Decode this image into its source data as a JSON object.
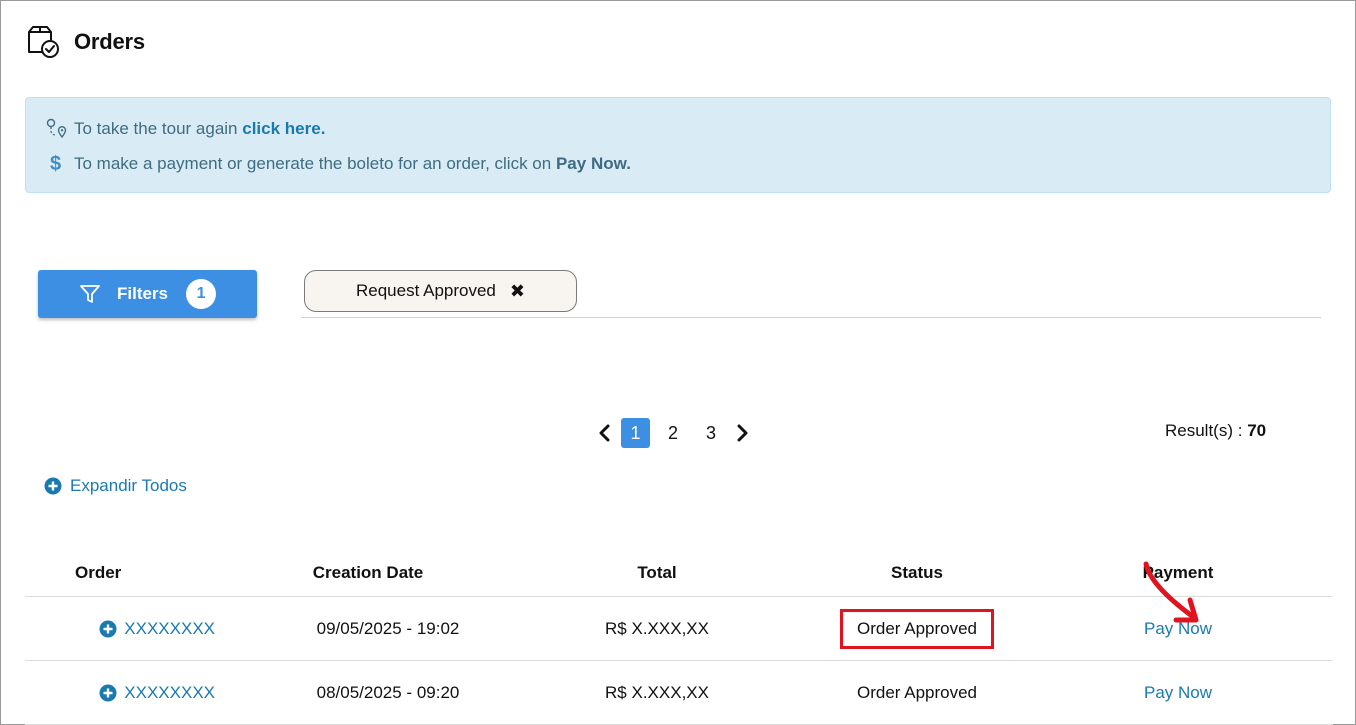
{
  "header": {
    "title": "Orders",
    "icon": "box-check-icon"
  },
  "info": {
    "tour_text": "To take the tour again ",
    "tour_link": "click here.",
    "payment_text": "To make a payment or generate the boleto for an order, click on ",
    "payment_bold": "Pay Now.",
    "dollar": "$"
  },
  "filters": {
    "label": "Filters",
    "count": "1",
    "chip_label": "Request Approved",
    "chip_close": "✖"
  },
  "pagination": {
    "pages": [
      "1",
      "2",
      "3"
    ],
    "active": "1"
  },
  "results": {
    "label": "Result(s) : ",
    "count": "70"
  },
  "expand_all": "Expandir Todos",
  "table": {
    "headers": {
      "order": "Order",
      "date": "Creation Date",
      "total": "Total",
      "status": "Status",
      "payment": "Payment"
    },
    "rows": [
      {
        "order": "XXXXXXXX",
        "date": "09/05/2025 - 19:02",
        "total": "R$ X.XXX,XX",
        "status": "Order Approved",
        "payment": "Pay Now"
      },
      {
        "order": "XXXXXXXX",
        "date": "08/05/2025 - 09:20",
        "total": "R$ X.XXX,XX",
        "status": "Order Approved",
        "payment": "Pay Now"
      }
    ]
  },
  "colors": {
    "primary": "#3d8fe4",
    "link": "#1a7ab0",
    "info_bg": "#d9ecf5",
    "highlight": "#e0141e"
  }
}
